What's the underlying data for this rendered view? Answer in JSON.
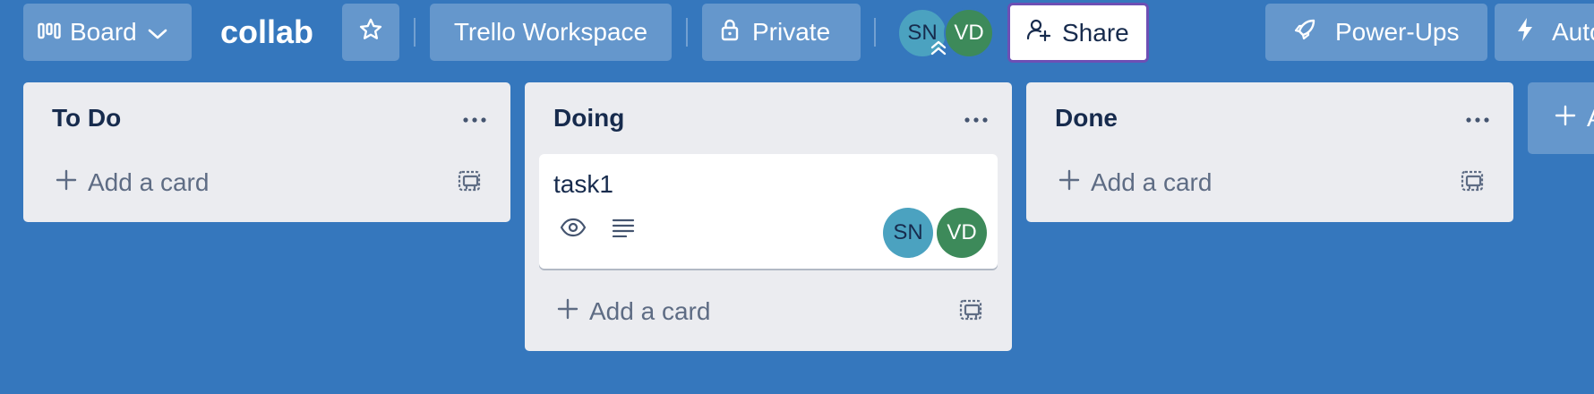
{
  "header": {
    "view_label": "Board",
    "board_title": "collab",
    "workspace_label": "Trello Workspace",
    "visibility_label": "Private",
    "members": [
      {
        "initials": "SN",
        "color": "#4ba2c0"
      },
      {
        "initials": "VD",
        "color": "#3d8a5a"
      }
    ],
    "share_label": "Share",
    "powerups_label": "Power-Ups",
    "automation_label": "Auto"
  },
  "lists": [
    {
      "title": "To Do",
      "add_card_label": "Add a card"
    },
    {
      "title": "Doing",
      "add_card_label": "Add a card",
      "cards": [
        {
          "title": "task1",
          "badges": [
            "eye-icon",
            "description-icon"
          ],
          "members": [
            "SN",
            "VD"
          ]
        }
      ]
    },
    {
      "title": "Done",
      "add_card_label": "Add a card"
    }
  ],
  "add_list_label": "A",
  "colors": {
    "board_background": "#3577bd",
    "list_background": "#ebecf0",
    "share_border": "#6d4fb4",
    "text_primary": "#172b4d",
    "text_secondary": "#5e6c84"
  }
}
